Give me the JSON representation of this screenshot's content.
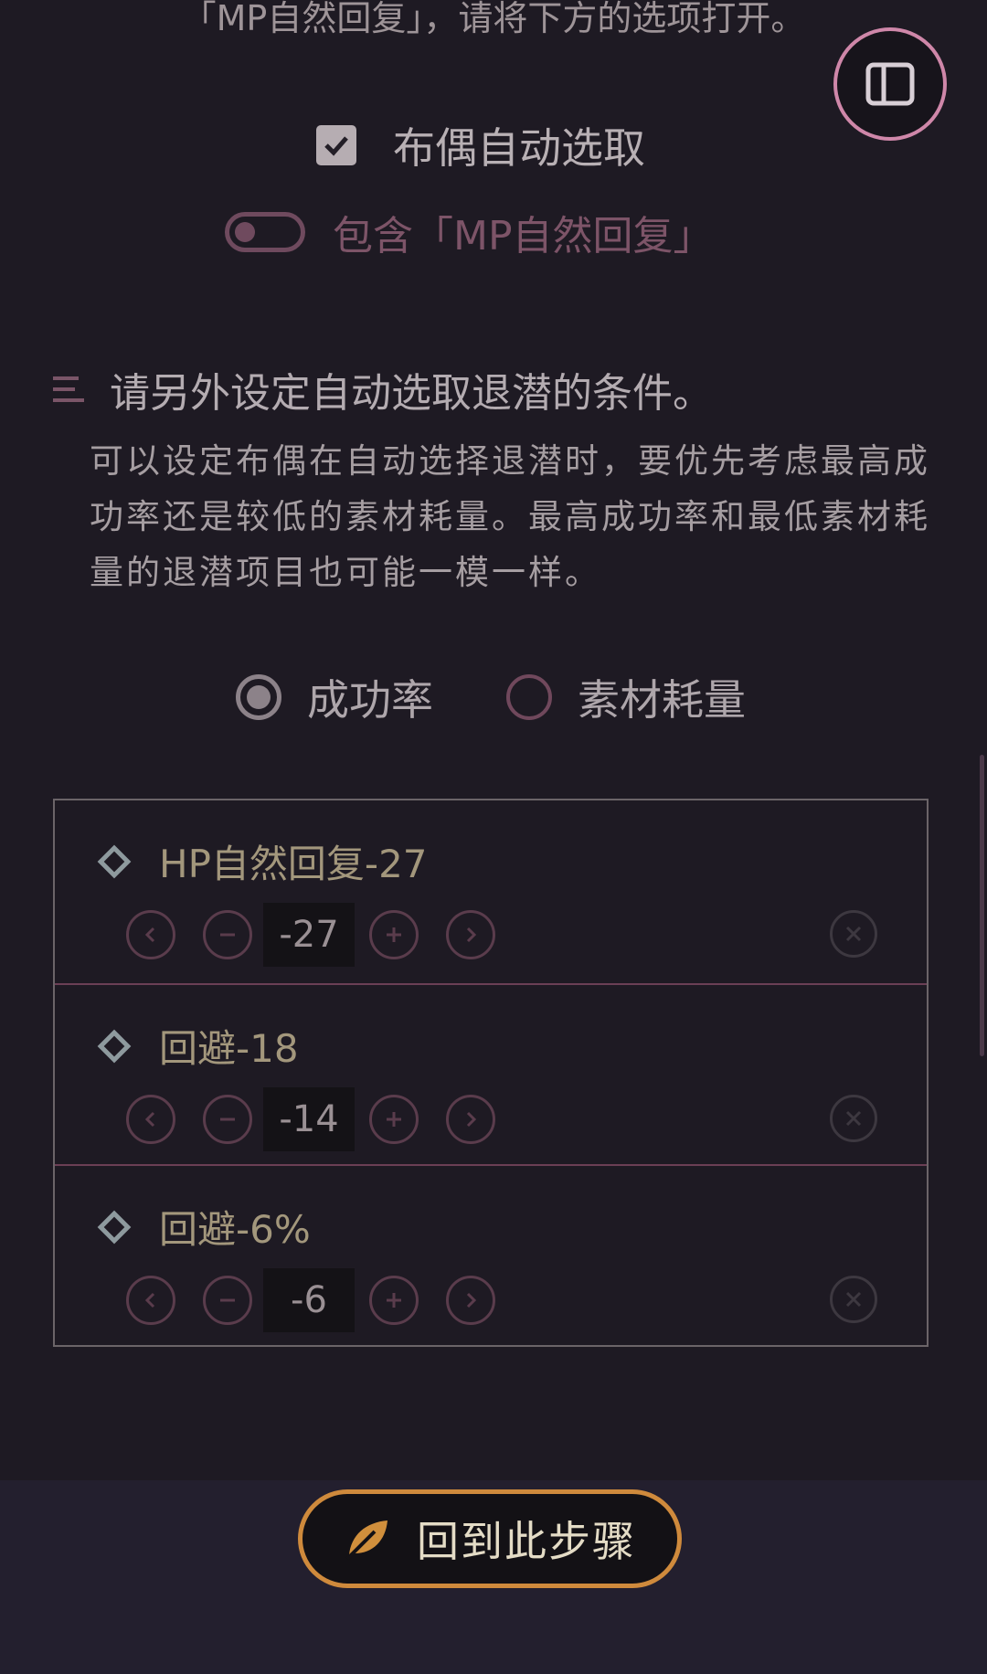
{
  "top_note": "「MP自然回复」，请将下方的选项打开。",
  "auto_select": {
    "label": "布偶自动选取",
    "checked": true
  },
  "include_mp": {
    "label": "包含「MP自然回复」",
    "on": false
  },
  "section": {
    "title": "请另外设定自动选取退潜的条件。",
    "description": "可以设定布偶在自动选择退潜时，要优先考虑最高成功率还是较低的素材耗量。最高成功率和最低素材耗量的退潜项目也可能一模一样。"
  },
  "priority": {
    "options": [
      {
        "label": "成功率",
        "selected": true
      },
      {
        "label": "素材耗量",
        "selected": false
      }
    ]
  },
  "items": [
    {
      "name": "HP自然回复-27",
      "value": "-27"
    },
    {
      "name": "回避-18",
      "value": "-14"
    },
    {
      "name": "回避-6%",
      "value": "-6"
    }
  ],
  "back_button": {
    "label": "回到此步骤"
  },
  "colors": {
    "accent_pink": "#cf87a9",
    "accent_orange": "#cf8a3c",
    "background": "#1e1a23"
  },
  "icons": [
    "sidebar-toggle-icon",
    "menu-lines-icon",
    "leaf-icon",
    "chevron-left-icon",
    "minus-icon",
    "plus-icon",
    "chevron-right-icon",
    "close-icon",
    "diamond-icon"
  ]
}
